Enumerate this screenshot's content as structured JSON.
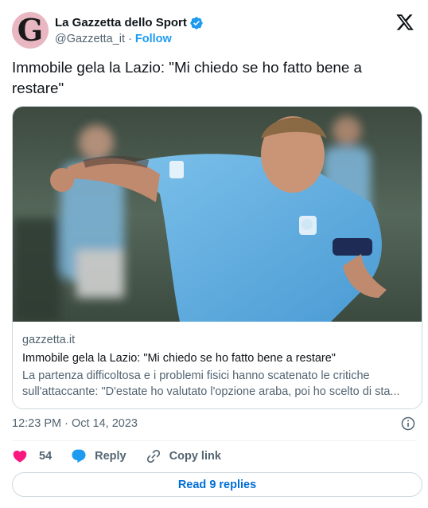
{
  "account": {
    "avatar_letter": "G",
    "avatar_color": "#e9b7c2",
    "display_name": "La Gazzetta dello Sport",
    "verified_icon": "verified-badge-icon",
    "handle": "@Gazzetta_it",
    "separator": "·",
    "follow_label": "Follow"
  },
  "brand_icon": "x-logo-icon",
  "tweet": {
    "text": "Immobile gela la Lazio: \"Mi chiedo se ho fatto bene a restare\""
  },
  "link_card": {
    "image_subject": "football-player-photo",
    "domain": "gazzetta.it",
    "title": "Immobile gela la Lazio: \"Mi chiedo se ho fatto bene a restare\"",
    "description": "La partenza difficoltosa e i problemi fisici hanno scatenato le critiche sull'attaccante: \"D'estate ho valutato l'opzione araba, poi ho scelto di sta..."
  },
  "meta": {
    "timestamp": "12:23 PM · Oct 14, 2023",
    "info_icon": "info-icon"
  },
  "actions": {
    "like_count": "54",
    "reply_label": "Reply",
    "copy_link_label": "Copy link"
  },
  "replies_button": "Read 9 replies",
  "colors": {
    "accent": "#1d9bf0",
    "like": "#f91880",
    "link_blue": "#006fd6",
    "muted": "#536471",
    "border": "#cfd9de"
  }
}
